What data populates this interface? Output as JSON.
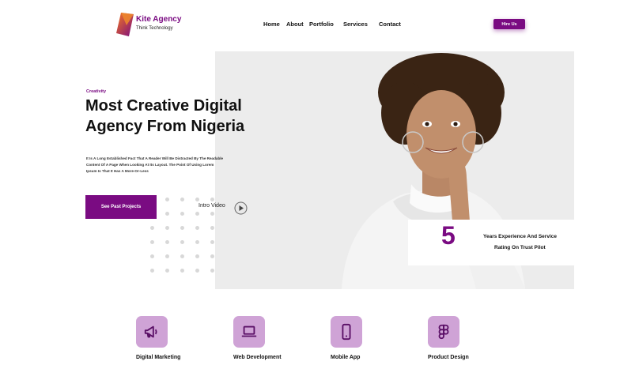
{
  "brand": {
    "name": "Kite Agency",
    "tagline": "Think Technology"
  },
  "nav": [
    "Home",
    "About",
    "Portfolio",
    "Services",
    "Contact"
  ],
  "header": {
    "hire_label": "Hire Us"
  },
  "hero": {
    "eyebrow": "Creativity",
    "headline_line1": "Most Creative Digital",
    "headline_line2": "Agency From Nigeria",
    "body_line1": "It Is A Long Established Fact That A Reader Will Be Distracted By The Readable",
    "body_line2": "Content Of A Page When Looking At Its Layout. The Point Of Using Lorem",
    "body_line3": "Ipsum Is That It Has A More-Or-Less",
    "cta_label": "See Past Projects",
    "intro_label": "Intro Video"
  },
  "stats": {
    "number": "5",
    "line1": "Years Experience  And Service",
    "line2": "Rating On Trust Pilot"
  },
  "services": [
    {
      "label": "Digital Marketing",
      "icon": "megaphone-icon"
    },
    {
      "label": "Web Development",
      "icon": "laptop-icon"
    },
    {
      "label": "Mobile App",
      "icon": "mobile-icon"
    },
    {
      "label": "Product Design",
      "icon": "figma-icon"
    }
  ],
  "colors": {
    "accent": "#7a0b82",
    "icon_tile": "#cfa3d6",
    "dot_grid": "#d8d8d8",
    "hero_bg": "#ececec"
  }
}
